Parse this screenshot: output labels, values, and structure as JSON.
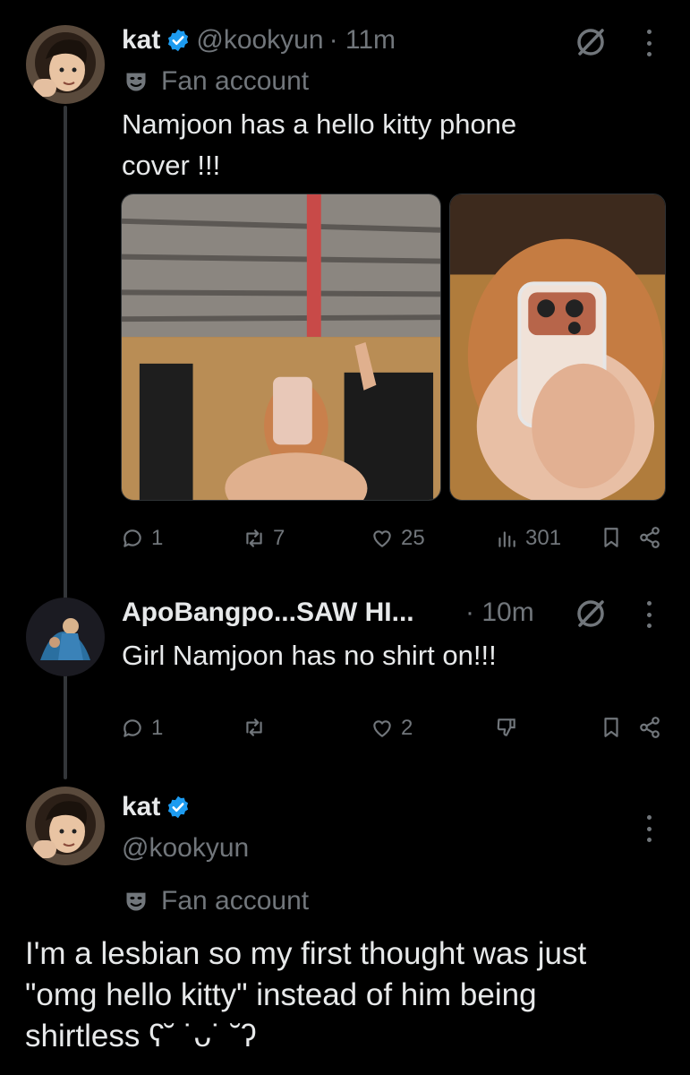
{
  "tweet1": {
    "display_name": "kat",
    "handle": "@kookyun",
    "time": "· 11m",
    "label": "Fan account",
    "text_line1": "Namjoon has a hello kitty phone",
    "text_line2": "cover !!!",
    "replies": "1",
    "retweets": "7",
    "likes": "25",
    "views": "301"
  },
  "tweet2": {
    "display_name": "ApoBangpo...SAW HI...",
    "time": "· 10m",
    "text": "Girl Namjoon has no shirt on!!!",
    "replies": "1",
    "likes": "2"
  },
  "tweet3": {
    "display_name": "kat",
    "handle": "@kookyun",
    "label": "Fan account",
    "text_line1": "I'm a lesbian so my first thought was just",
    "text_line2": "\"omg hello kitty\" instead of him being",
    "text_line3": "shirtless ʕ˘ ˙ᴗ˙ ˘ʔ"
  },
  "colors": {
    "background": "#000000",
    "text": "#e7e9ea",
    "muted": "#71767b",
    "verified": "#1d9bf0",
    "thread_line": "#333639"
  },
  "icons": [
    "verified-badge-icon",
    "mask-icon",
    "grok-icon",
    "more-icon",
    "reply-icon",
    "retweet-icon",
    "like-icon",
    "views-icon",
    "bookmark-icon",
    "share-icon",
    "downvote-icon"
  ]
}
